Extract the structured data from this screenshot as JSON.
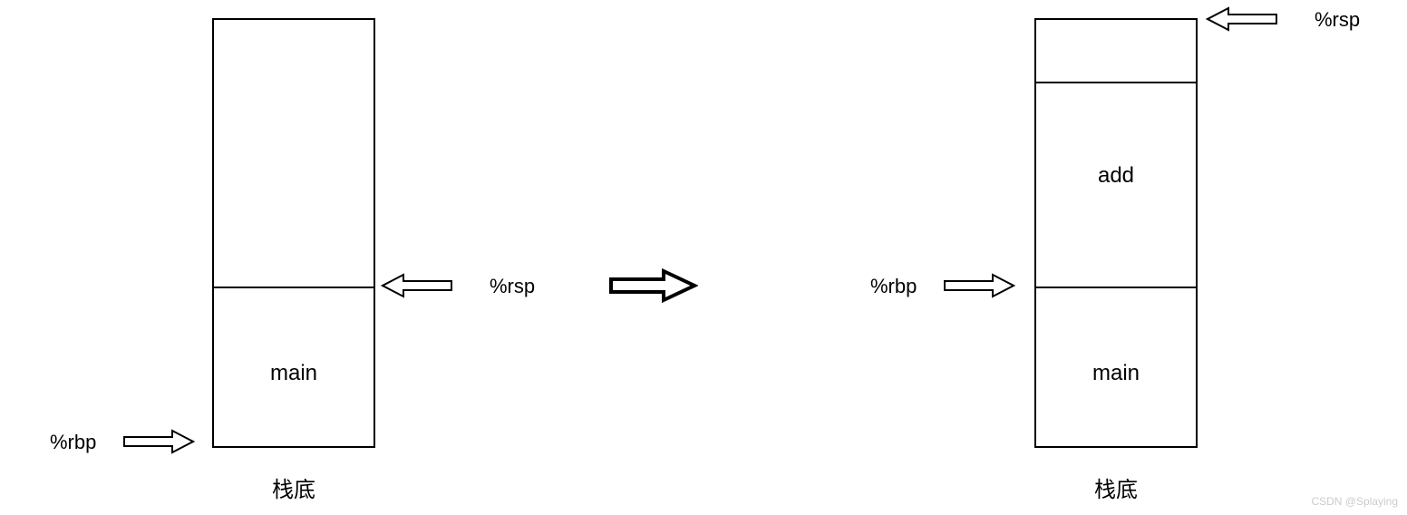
{
  "left_stack": {
    "frame1_label": "main",
    "bottom_label": "栈底",
    "rbp_label": "%rbp",
    "rsp_label": "%rsp"
  },
  "right_stack": {
    "frame1_label": "add",
    "frame2_label": "main",
    "bottom_label": "栈底",
    "rbp_label": "%rbp",
    "rsp_label": "%rsp"
  },
  "watermark": "CSDN @Splaying"
}
